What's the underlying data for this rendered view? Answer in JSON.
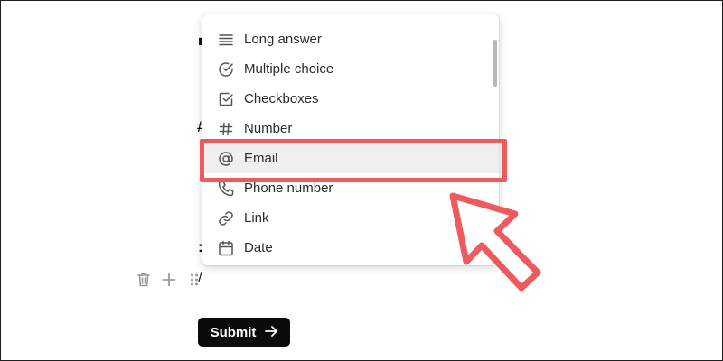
{
  "editor": {
    "slash_text": "/"
  },
  "dropdown": {
    "items": [
      {
        "label": "Long answer",
        "icon": "long-answer-icon"
      },
      {
        "label": "Multiple choice",
        "icon": "multiple-choice-icon"
      },
      {
        "label": "Checkboxes",
        "icon": "checkbox-icon"
      },
      {
        "label": "Number",
        "icon": "hash-icon"
      },
      {
        "label": "Email",
        "icon": "at-sign-icon"
      },
      {
        "label": "Phone number",
        "icon": "phone-icon"
      },
      {
        "label": "Link",
        "icon": "link-icon"
      },
      {
        "label": "Date",
        "icon": "calendar-icon"
      }
    ],
    "selected_label": "Email"
  },
  "submit": {
    "label": "Submit",
    "icon": "arrow-right-icon"
  },
  "colors": {
    "highlight": "#ee5b5f",
    "button_bg": "#0b0b0b",
    "selected_bg": "#efefef"
  }
}
